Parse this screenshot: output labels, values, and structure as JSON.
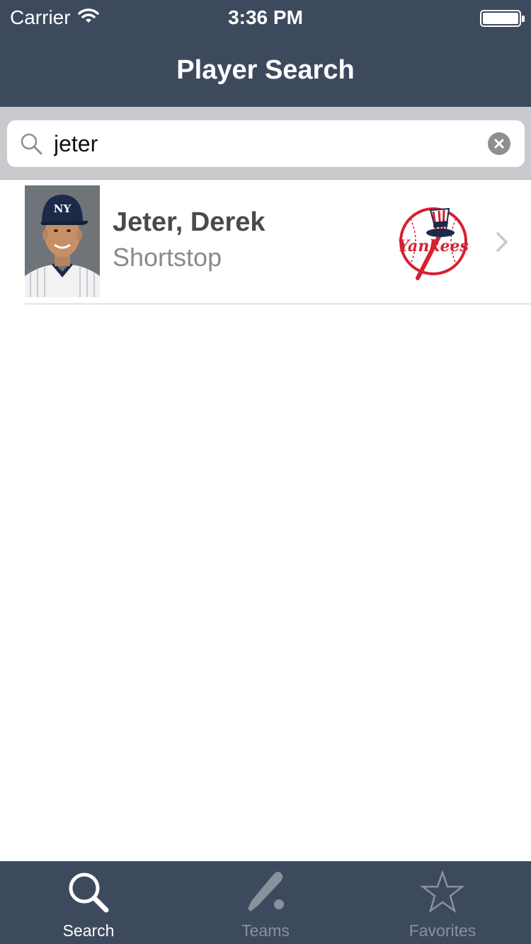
{
  "status_bar": {
    "carrier": "Carrier",
    "time": "3:36 PM"
  },
  "nav": {
    "title": "Player Search"
  },
  "search": {
    "value": "jeter",
    "placeholder": ""
  },
  "results": [
    {
      "name": "Jeter, Derek",
      "position": "Shortstop",
      "team_logo_text": "Yankees"
    }
  ],
  "tab_bar": {
    "tabs": [
      {
        "label": "Search",
        "icon": "search-icon",
        "active": true
      },
      {
        "label": "Teams",
        "icon": "baseball-bat-icon",
        "active": false
      },
      {
        "label": "Favorites",
        "icon": "star-icon",
        "active": false
      }
    ]
  },
  "colors": {
    "bar_background": "#3d4a5e",
    "search_area_background": "#c9c9ce",
    "active_tab": "#ffffff",
    "inactive_tab": "#8a919c",
    "logo_red": "#d62030",
    "logo_navy": "#1c2a4a"
  }
}
